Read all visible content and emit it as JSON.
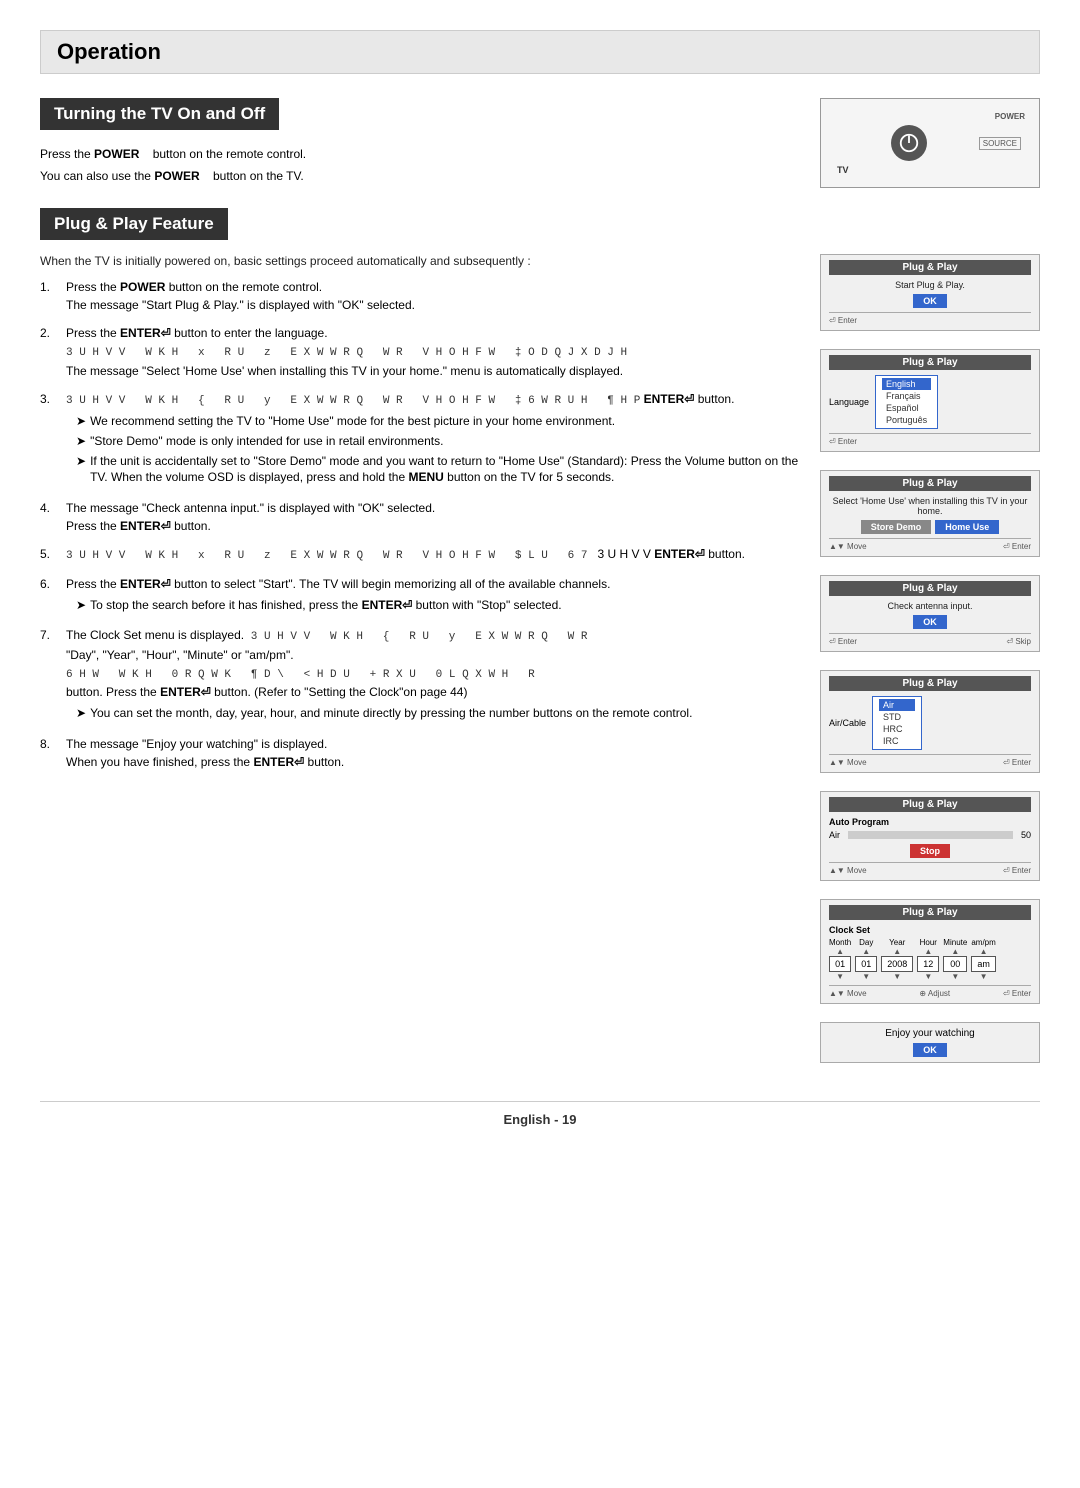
{
  "page": {
    "operation_title": "Operation",
    "section1_title": "Turning the TV On and Off",
    "section2_title": "Plug & Play Feature",
    "turning_lines": [
      {
        "text_before": "Press the ",
        "bold": "POWER",
        "text_after": "   button on the remote control."
      },
      {
        "text_before": "You can also use the ",
        "bold": "POWER",
        "text_after": "   button on the TV."
      }
    ],
    "plug_intro": "When the TV is initially powered on, basic settings proceed automatically and subsequently :",
    "steps": [
      {
        "num": "1.",
        "text_before": "Press the ",
        "bold": "POWER",
        "text_after": " button on the remote control.",
        "sub": "The message \"Start Plug & Play.\" is displayed with \"OK\" selected."
      },
      {
        "num": "2.",
        "text_before": "Press the ",
        "bold": "ENTER",
        "text_after": "⏎ button to enter the language.",
        "sub_scrambled": "3 U H V V   W K H  x  R U  z  E X W W R Q  W R  V H O H F W ‡ O D Q J X D J H",
        "sub2": "The message \"Select 'Home Use' when installing this TV in your home.\" menu is automatically displayed."
      },
      {
        "num": "3.",
        "scrambled": "3 U H V V  W K H  {  R U  y  E X W W R Q  W R  V H O H F W  ‡ 6 W R U H  ¶ H P",
        "bold_suffix": "ENTER⏎",
        "text_after": " button.",
        "bullets": [
          "We recommend setting the TV to \"Home Use\" mode for the best picture in your home environment.",
          "\"Store Demo\" mode is only intended for use in retail environments.",
          "If the unit is accidentally set to \"Store Demo\" mode and you want to return to \"Home Use\" (Standard): Press the Volume button on the TV. When the volume OSD is displayed, press and hold the MENU button on the TV for 5 seconds."
        ]
      },
      {
        "num": "4.",
        "text": "The message \"Check antenna input.\" is displayed with \"OK\" selected.",
        "text2_before": "Press the ",
        "bold2": "ENTER⏎",
        "text2_after": " button."
      },
      {
        "num": "5.",
        "scrambled": "3 U H V V  W K H  x  R U  z  E X W W R Q  W R  V H O H F W  $ L U  6 7",
        "text_after_bold": "3 U H V V",
        "bold_suffix2": "ENTER⏎",
        "text_suffix2": " button."
      },
      {
        "num": "6.",
        "text_before": "Press the ",
        "bold": "ENTER⏎",
        "text_after": " button to select \"Start\". The TV will begin memorizing all of the available channels.",
        "bullet": "To stop the search before it has finished, press the ENTER⏎ button with \"Stop\" selected."
      },
      {
        "num": "7.",
        "text": "The Clock Set menu is displayed.",
        "scrambled2": "3 U H V V  W K H  {  R U  y  E X W W R Q  W R",
        "text2": "\"Day\", \"Year\", \"Hour\", \"Minute\" or \"am/pm\".",
        "scrambled3": "6 H W  W K H  0 R Q W K  ¶ D \\ < H D U  + R X U  0 L Q X W H  R",
        "bold3": "",
        "text3": "button. Press the ",
        "bold4": "ENTER⏎",
        "text4": " button. (Refer to \"Setting the Clock\"on page 44)",
        "bullet2": "You can set the month, day, year, hour, and minute directly by pressing the number buttons on the remote control."
      },
      {
        "num": "8.",
        "text": "The message \"Enjoy your watching\" is displayed.",
        "text2_before": "When you have finished, press the ",
        "bold2": "ENTER⏎",
        "text2_after": " button."
      }
    ],
    "footer_text": "English - 19",
    "panels": {
      "panel1": {
        "title": "Plug & Play",
        "body": "Start Plug & Play.",
        "btn": "OK",
        "bottom": "⏎ Enter"
      },
      "panel2": {
        "title": "Plug & Play",
        "label": "Language",
        "languages": [
          "English",
          "Français",
          "Español",
          "Português"
        ],
        "selected": "English",
        "bottom": "⏎ Enter"
      },
      "panel3": {
        "title": "Plug & Play",
        "body": "Select 'Home Use' when installing this TV in your home.",
        "btn1": "Store Demo",
        "btn2": "Home Use",
        "bottom": "⏎ Enter"
      },
      "panel4": {
        "title": "Plug & Play",
        "body": "Check antenna input.",
        "btn": "OK",
        "bottom_left": "⏎ Enter",
        "bottom_right": "⏎ Skip"
      },
      "panel5": {
        "title": "Plug & Play",
        "label": "Air/Cable",
        "options": [
          "Air",
          "STD",
          "HRC",
          "IRC"
        ],
        "selected": "Air",
        "bottom": "⏎ Enter"
      },
      "panel6": {
        "title": "Plug & Play",
        "label": "Auto Program",
        "air_label": "Air",
        "channel_num": "50",
        "btn": "Stop",
        "bottom": "⏎ Enter"
      },
      "panel7": {
        "title": "Plug & Play",
        "label": "Clock Set",
        "cols": [
          "Month",
          "Day",
          "Year",
          "Hour",
          "Minute",
          "am/pm"
        ],
        "values": [
          "01",
          "01",
          "2008",
          "12",
          "00",
          "am"
        ],
        "bottom_left": "▲▼ Move",
        "bottom_mid": "⊕ Adjust",
        "bottom_right": "⏎ Enter"
      },
      "panel8": {
        "title": "",
        "body": "Enjoy your watching",
        "btn": "OK"
      }
    }
  }
}
